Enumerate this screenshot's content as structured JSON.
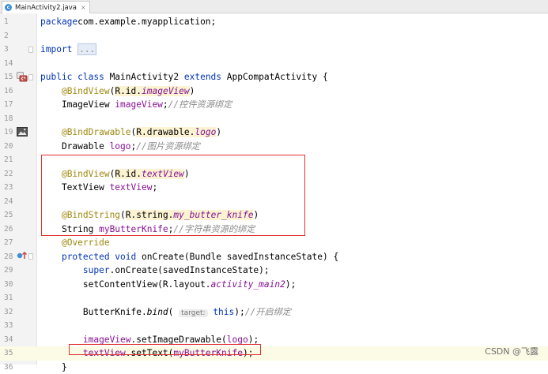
{
  "tab": {
    "filename": "MainActivity2.java",
    "close_glyph": "×",
    "file_icon_letter": "c"
  },
  "lines": [
    {
      "num": "1",
      "tokens": [
        [
          "kw",
          "package"
        ],
        [
          "",
          "com.example.myapplication;"
        ]
      ]
    },
    {
      "num": "2",
      "tokens": []
    },
    {
      "num": "3",
      "tokens": [
        [
          "kw",
          "import"
        ],
        [
          "",
          " "
        ],
        [
          "fold",
          "..."
        ]
      ]
    },
    {
      "num": "14",
      "tokens": []
    },
    {
      "num": "15",
      "tokens": [
        [
          "kw",
          "public class"
        ],
        [
          "",
          " MainActivity2 "
        ],
        [
          "kw",
          "extends"
        ],
        [
          "",
          " AppCompatActivity {"
        ]
      ]
    },
    {
      "num": "16",
      "tokens": [
        [
          "",
          "    "
        ],
        [
          "ann",
          "@BindView"
        ],
        [
          "",
          "("
        ],
        [
          "rid",
          "R.id."
        ],
        [
          "fld italic rid",
          "imageView"
        ],
        [
          "",
          ")"
        ]
      ]
    },
    {
      "num": "17",
      "tokens": [
        [
          "",
          "    ImageView "
        ],
        [
          "fld",
          "imageView"
        ],
        [
          "",
          ";"
        ],
        [
          "cm",
          "//控件资源绑定"
        ]
      ]
    },
    {
      "num": "18",
      "tokens": []
    },
    {
      "num": "19",
      "tokens": [
        [
          "",
          "    "
        ],
        [
          "ann",
          "@BindDrawable"
        ],
        [
          "",
          "("
        ],
        [
          "rid",
          "R.drawable."
        ],
        [
          "fld italic rid",
          "logo"
        ],
        [
          "",
          ")"
        ]
      ]
    },
    {
      "num": "20",
      "tokens": [
        [
          "",
          "    Drawable "
        ],
        [
          "fld",
          "logo"
        ],
        [
          "",
          ";"
        ],
        [
          "cm",
          "//图片资源绑定"
        ]
      ]
    },
    {
      "num": "21",
      "tokens": []
    },
    {
      "num": "22",
      "tokens": [
        [
          "",
          "    "
        ],
        [
          "ann",
          "@BindView"
        ],
        [
          "",
          "("
        ],
        [
          "rid",
          "R.id."
        ],
        [
          "fld italic rid",
          "textView"
        ],
        [
          "",
          ")"
        ]
      ]
    },
    {
      "num": "23",
      "tokens": [
        [
          "",
          "    TextView "
        ],
        [
          "fld",
          "textView"
        ],
        [
          "",
          ";"
        ]
      ]
    },
    {
      "num": "24",
      "tokens": []
    },
    {
      "num": "25",
      "tokens": [
        [
          "",
          "    "
        ],
        [
          "ann",
          "@BindString"
        ],
        [
          "",
          "("
        ],
        [
          "rid",
          "R.string."
        ],
        [
          "fld italic rid",
          "my_butter_knife"
        ],
        [
          "",
          ")"
        ]
      ]
    },
    {
      "num": "26",
      "tokens": [
        [
          "",
          "    String "
        ],
        [
          "fld",
          "myButterKnife"
        ],
        [
          "",
          ";"
        ],
        [
          "cm",
          "//字符串资源的绑定"
        ]
      ]
    },
    {
      "num": "27",
      "tokens": [
        [
          "",
          "    "
        ],
        [
          "ann",
          "@Override"
        ]
      ]
    },
    {
      "num": "28",
      "tokens": [
        [
          "",
          "    "
        ],
        [
          "kw",
          "protected void"
        ],
        [
          "",
          " onCreate(Bundle savedInstanceState) {"
        ]
      ]
    },
    {
      "num": "29",
      "tokens": [
        [
          "",
          "        "
        ],
        [
          "kw",
          "super"
        ],
        [
          "",
          ".onCreate(savedInstanceState);"
        ]
      ]
    },
    {
      "num": "30",
      "tokens": [
        [
          "",
          "        setContentView(R.layout."
        ],
        [
          "fld italic",
          "activity_main2"
        ],
        [
          "",
          ");"
        ]
      ]
    },
    {
      "num": "31",
      "tokens": []
    },
    {
      "num": "32",
      "tokens": [
        [
          "",
          "        ButterKnife."
        ],
        [
          "italic",
          "bind"
        ],
        [
          "",
          "( "
        ],
        [
          "hint",
          "target:"
        ],
        [
          "",
          " "
        ],
        [
          "kw",
          "this"
        ],
        [
          "",
          ");"
        ],
        [
          "cm",
          "//开启绑定"
        ]
      ]
    },
    {
      "num": "33",
      "tokens": []
    },
    {
      "num": "34",
      "tokens": [
        [
          "",
          "        "
        ],
        [
          "fld",
          "imageView"
        ],
        [
          "",
          ".setImageDrawable("
        ],
        [
          "fld",
          "logo"
        ],
        [
          "",
          ");"
        ]
      ]
    },
    {
      "num": "35",
      "tokens": [
        [
          "",
          "        "
        ],
        [
          "fld",
          "textView"
        ],
        [
          "",
          ".setText("
        ],
        [
          "fld",
          "myButterKnife"
        ],
        [
          "",
          ");"
        ]
      ]
    },
    {
      "num": "36",
      "tokens": [
        [
          "",
          "    }"
        ]
      ]
    }
  ],
  "gutter_icons": {
    "15": "android-class-icon",
    "19": "image-preview-icon",
    "28": "override-method-icon"
  },
  "colors": {
    "keyword": "#0033b3",
    "annotation": "#9e880d",
    "field": "#871094",
    "comment": "#8c8c8c",
    "highlight_box": "#e03131"
  },
  "watermark": "CSDN @飞露"
}
